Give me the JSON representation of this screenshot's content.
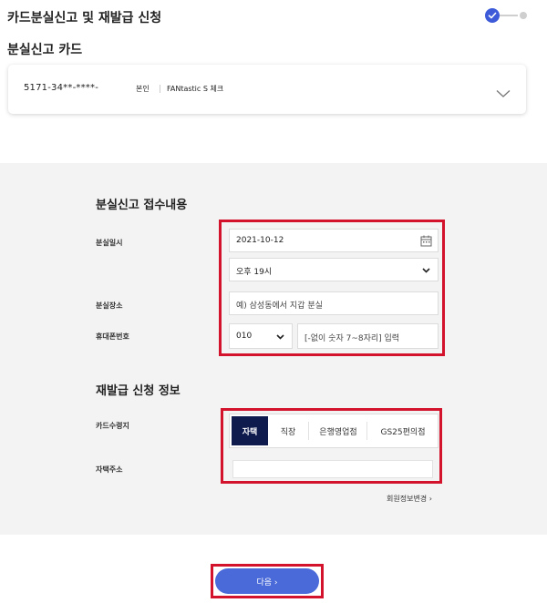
{
  "header": {
    "title": "카드분실신고 및 재발급 신청"
  },
  "card_section": {
    "title": "분실신고 카드",
    "card_number": "5171-34**-****-",
    "owner": "본인",
    "card_name": "FANtastic S 체크"
  },
  "report": {
    "heading": "분실신고 접수내용",
    "loss_datetime_label": "분실일시",
    "date_value": "2021-10-12",
    "time_value": "오후 19시",
    "loss_place_label": "분실장소",
    "loss_place_placeholder": "예) 삼성동에서 지갑 분실",
    "phone_label": "휴대폰번호",
    "phone_prefix": "010",
    "phone_placeholder": "[-없이 숫자 7~8자리] 입력"
  },
  "reissue": {
    "heading": "재발급 신청 정보",
    "receive_label": "카드수령지",
    "options": [
      "자택",
      "직장",
      "은행영업점",
      "GS25편의점"
    ],
    "selected": "자택",
    "address_label": "자택주소",
    "address_value": "",
    "member_info_link": "회원정보변경 ›"
  },
  "footer": {
    "next_label": "다음 ›",
    "next_color": "#4a6ad9"
  },
  "colors": {
    "highlight": "#d3132b",
    "accent": "#3d5bd9",
    "active_tab": "#0f1a4d"
  }
}
